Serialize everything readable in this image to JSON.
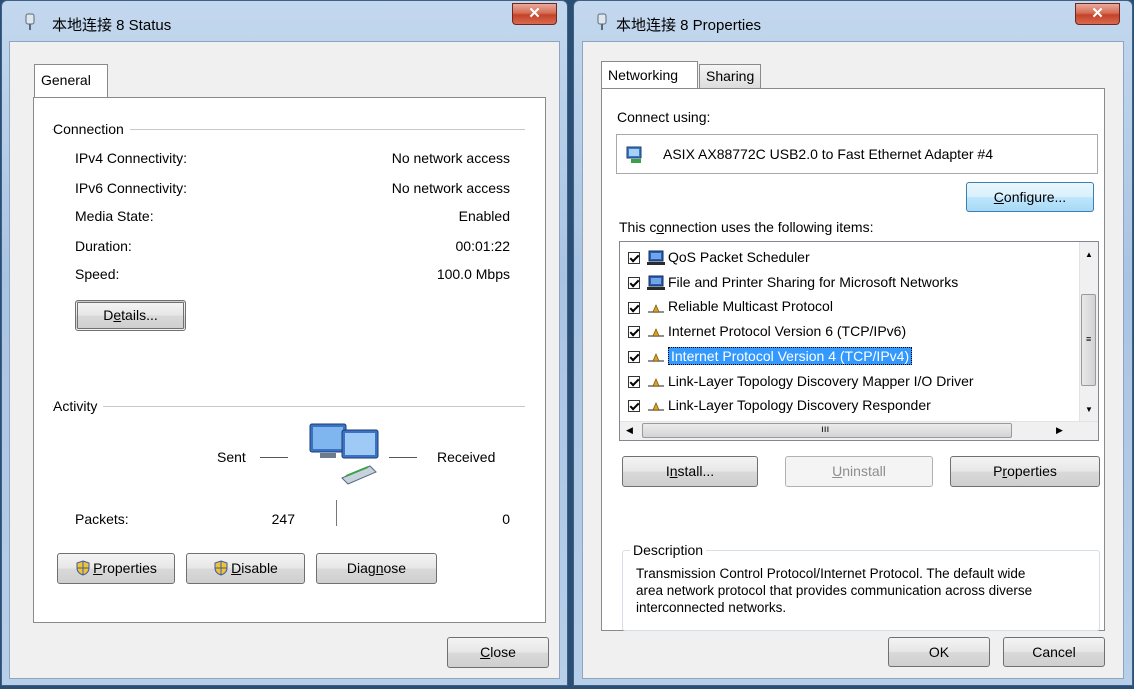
{
  "status_window": {
    "title": "本地连接 8 Status",
    "tab_general": "General",
    "connection_label": "Connection",
    "rows": [
      {
        "label": "IPv4 Connectivity:",
        "value": "No network access"
      },
      {
        "label": "IPv6 Connectivity:",
        "value": "No network access"
      },
      {
        "label": "Media State:",
        "value": "Enabled"
      },
      {
        "label": "Duration:",
        "value": "00:01:22"
      },
      {
        "label": "Speed:",
        "value": "100.0 Mbps"
      }
    ],
    "details_button": {
      "pre": "D",
      "u": "e",
      "post": "tails..."
    },
    "activity_label": "Activity",
    "sent_label": "Sent",
    "received_label": "Received",
    "packets_label": "Packets:",
    "packets_sent": "247",
    "packets_received": "0",
    "properties_button": {
      "pre": "",
      "u": "P",
      "post": "roperties"
    },
    "disable_button": {
      "pre": "",
      "u": "D",
      "post": "isable"
    },
    "diagnose_button": {
      "pre": "Diag",
      "u": "n",
      "post": "ose"
    },
    "close_button": {
      "pre": "",
      "u": "C",
      "post": "lose"
    }
  },
  "properties_window": {
    "title": "本地连接 8 Properties",
    "tab_networking": "Networking",
    "tab_sharing": "Sharing",
    "connect_using_label": "Connect using:",
    "adapter_name": "ASIX AX88772C USB2.0 to Fast Ethernet Adapter #4",
    "configure_button": {
      "pre": "",
      "u": "C",
      "post": "onfigure..."
    },
    "items_label": {
      "pre": "This c",
      "u": "o",
      "post": "nnection uses the following items:"
    },
    "items": [
      {
        "label": "QoS Packet Scheduler",
        "checked": true,
        "icon": "network-client-icon"
      },
      {
        "label": "File and Printer Sharing for Microsoft Networks",
        "checked": true,
        "icon": "network-client-icon"
      },
      {
        "label": "Reliable Multicast Protocol",
        "checked": true,
        "icon": "protocol-icon"
      },
      {
        "label": "Internet Protocol Version 6 (TCP/IPv6)",
        "checked": true,
        "icon": "protocol-icon"
      },
      {
        "label": "Internet Protocol Version 4 (TCP/IPv4)",
        "checked": true,
        "icon": "protocol-icon",
        "selected": true
      },
      {
        "label": "Link-Layer Topology Discovery Mapper I/O Driver",
        "checked": true,
        "icon": "protocol-icon"
      },
      {
        "label": "Link-Layer Topology Discovery Responder",
        "checked": true,
        "icon": "protocol-icon"
      }
    ],
    "install_button": {
      "pre": "I",
      "u": "n",
      "post": "stall..."
    },
    "uninstall_button": {
      "pre": "",
      "u": "U",
      "post": "ninstall"
    },
    "properties_button": {
      "pre": "P",
      "u": "r",
      "post": "operties"
    },
    "description_label": "Description",
    "description_text": "Transmission Control Protocol/Internet Protocol. The default wide area network protocol that provides communication across diverse interconnected networks.",
    "ok_button": "OK",
    "cancel_button": "Cancel"
  }
}
